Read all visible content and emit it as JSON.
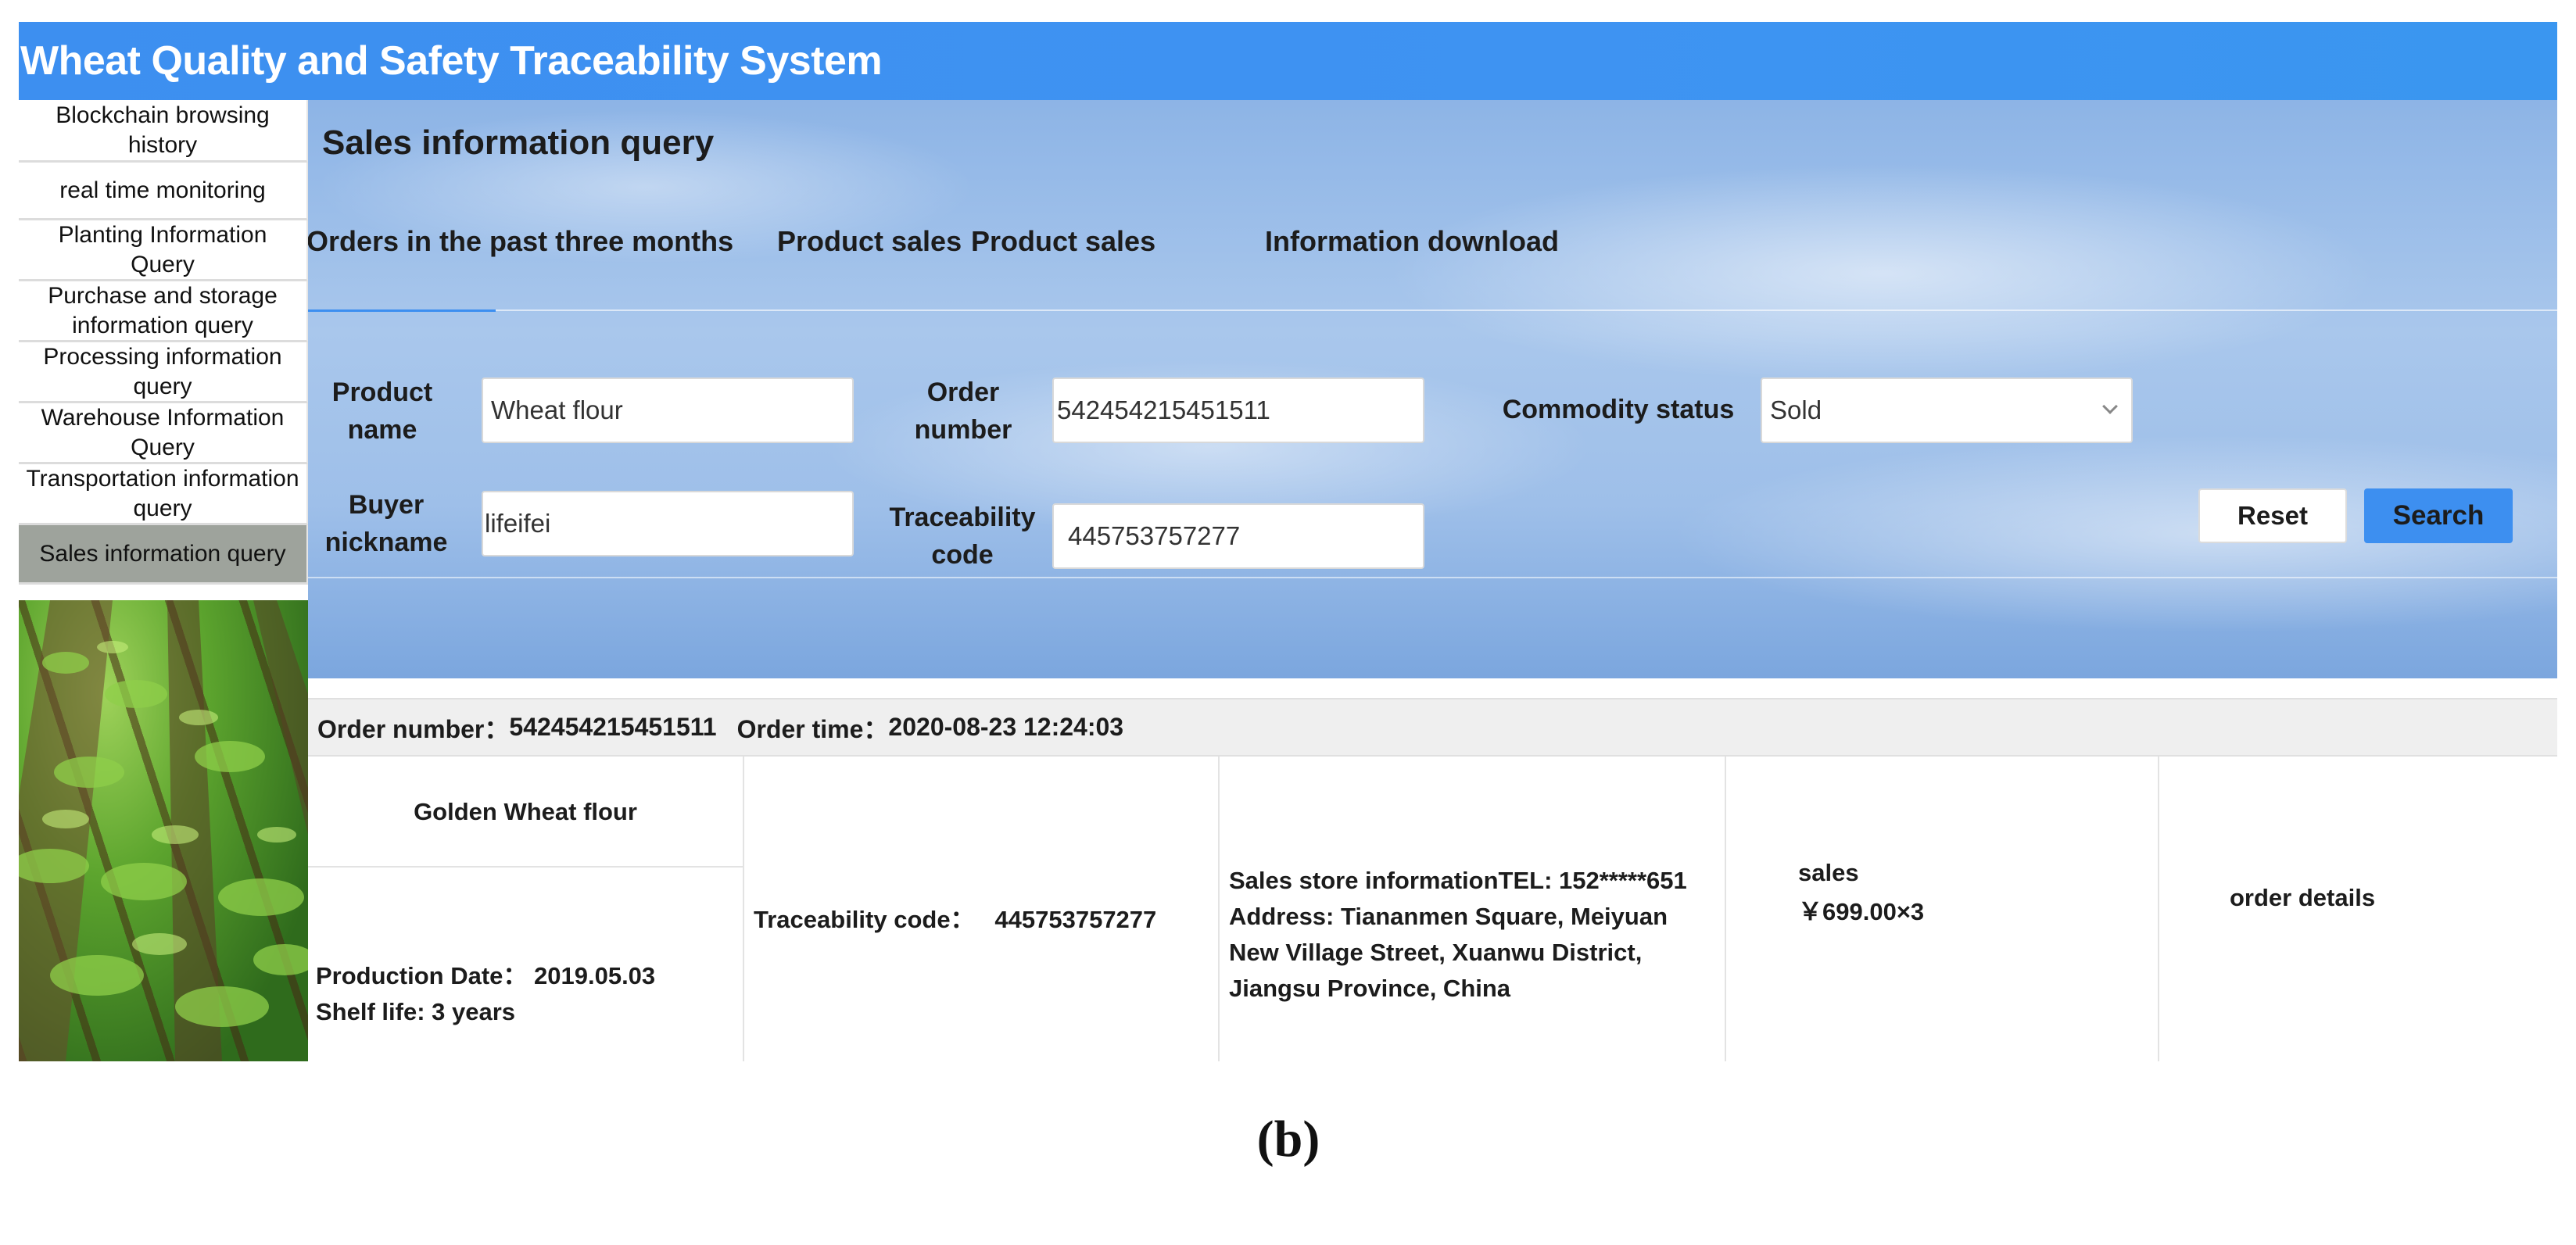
{
  "app": {
    "title": "Wheat Quality and Safety Traceability System"
  },
  "sidebar": {
    "items": [
      {
        "label": "Blockchain browsing history"
      },
      {
        "label": "real time monitoring"
      },
      {
        "label": "Planting Information Query"
      },
      {
        "label": "Purchase and storage information query"
      },
      {
        "label": "Processing information query"
      },
      {
        "label": "Warehouse Information Query"
      },
      {
        "label": "Transportation information query"
      },
      {
        "label": "Sales information query"
      }
    ],
    "active_index": 7
  },
  "page": {
    "title": "Sales information query"
  },
  "tabs": [
    {
      "label": "Orders in the past three months"
    },
    {
      "label": "Product sales"
    },
    {
      "label": "Product sales"
    },
    {
      "label": "Information download"
    }
  ],
  "form": {
    "product_name_label": "Product name",
    "product_name_value": "Wheat flour",
    "order_number_label": "Order number",
    "order_number_value": "542454215451511",
    "commodity_status_label": "Commodity status",
    "commodity_status_value": "Sold",
    "buyer_nickname_label": "Buyer nickname",
    "buyer_nickname_value": "lifeifei",
    "traceability_code_label": "Traceability code",
    "traceability_code_value": "445753757277",
    "reset_label": "Reset",
    "search_label": "Search"
  },
  "order": {
    "number_label": "Order number：",
    "number": "542454215451511",
    "time_label": "Order time：",
    "time": "2020-08-23 12:24:03",
    "product_name": "Golden Wheat flour",
    "production_date": "Production Date：  2019.05.03",
    "shelf_life": "Shelf life: 3 years",
    "traceability": "Traceability code：   445753757277",
    "store_lines": [
      "Sales store informationTEL: 152*****651",
      "Address: Tiananmen Square, Meiyuan",
      "New Village Street, Xuanwu District,",
      "Jiangsu Province, China"
    ],
    "sales_label": "sales",
    "sales_value": "￥699.00×3",
    "details_label": "order details"
  },
  "caption": "(b)",
  "colors": {
    "accent": "#3d8ff0",
    "active_sidebar": "#9ea39c",
    "header_row": "#efefef"
  }
}
